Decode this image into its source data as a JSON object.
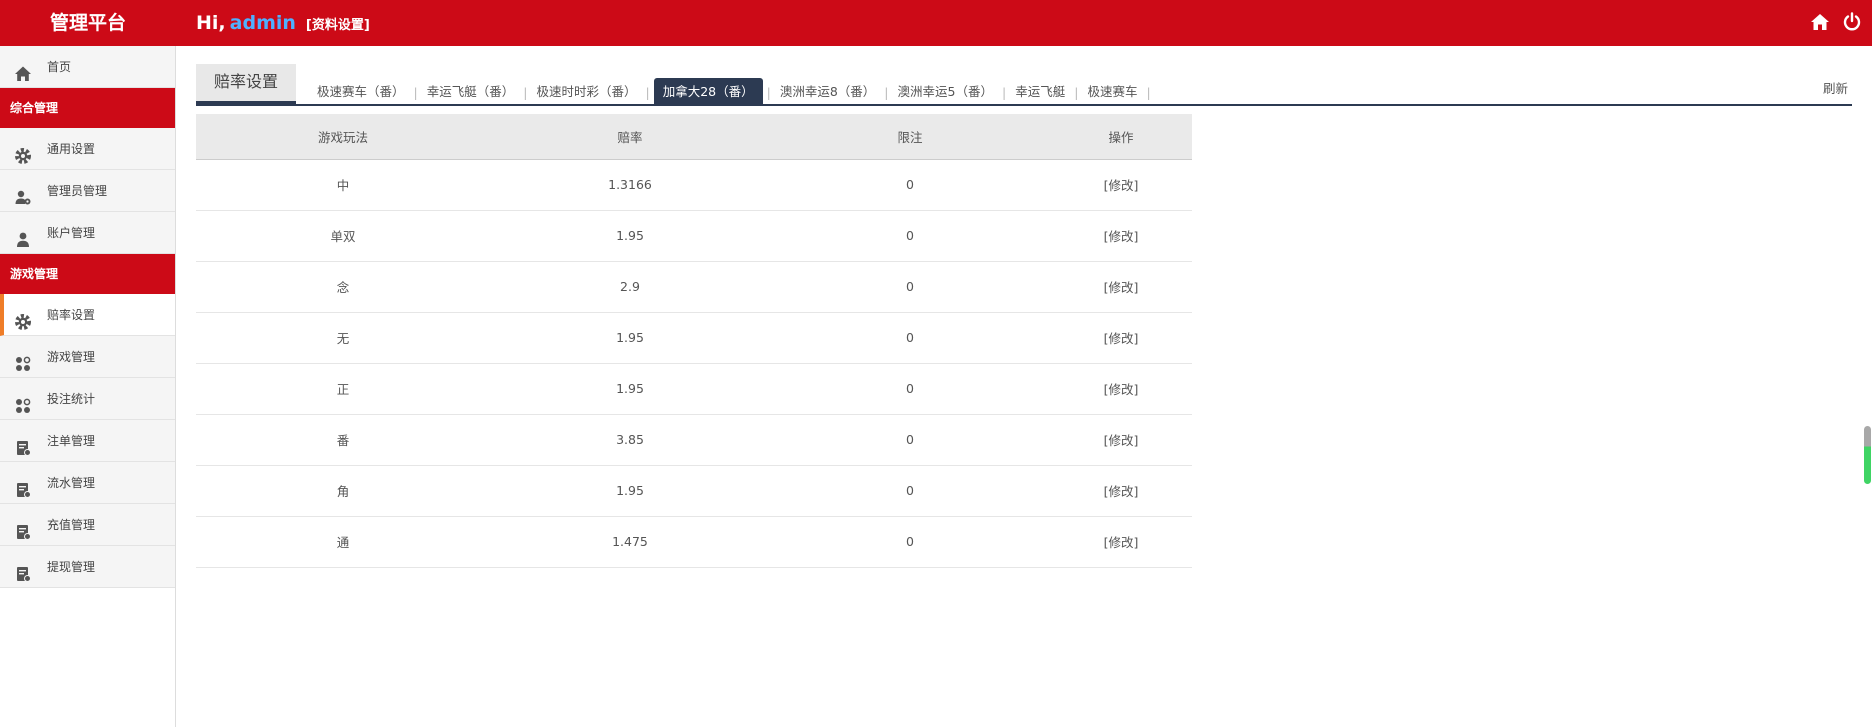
{
  "header": {
    "brand": "管理平台",
    "greeting": "Hi,",
    "username": "admin",
    "profile_link": "[资料设置]",
    "icons": [
      "home-icon",
      "power-icon"
    ]
  },
  "sidebar": {
    "home": "首页",
    "section_general": "综合管理",
    "general_items": [
      {
        "label": "通用设置",
        "icon": "gear-icon"
      },
      {
        "label": "管理员管理",
        "icon": "admin-users-icon"
      },
      {
        "label": "账户管理",
        "icon": "user-icon"
      }
    ],
    "section_game": "游戏管理",
    "game_items": [
      {
        "label": "赔率设置",
        "icon": "gear-icon",
        "active": true
      },
      {
        "label": "游戏管理",
        "icon": "apps-icon"
      },
      {
        "label": "投注统计",
        "icon": "apps-icon"
      },
      {
        "label": "注单管理",
        "icon": "ledger-icon"
      },
      {
        "label": "流水管理",
        "icon": "ledger-icon"
      },
      {
        "label": "充值管理",
        "icon": "ledger-icon"
      },
      {
        "label": "提现管理",
        "icon": "ledger-icon"
      }
    ]
  },
  "tabs": {
    "main": "赔率设置",
    "games": [
      "极速赛车（番）",
      "幸运飞艇（番）",
      "极速时时彩（番）",
      "加拿大28（番）",
      "澳洲幸运8（番）",
      "澳洲幸运5（番）",
      "幸运飞艇",
      "极速赛车"
    ],
    "active_game": "加拿大28（番）",
    "refresh": "刷新"
  },
  "table": {
    "headers": [
      "游戏玩法",
      "赔率",
      "限注",
      "操作"
    ],
    "rows": [
      [
        "中",
        "1.3166",
        "0",
        "[修改]"
      ],
      [
        "单双",
        "1.95",
        "0",
        "[修改]"
      ],
      [
        "念",
        "2.9",
        "0",
        "[修改]"
      ],
      [
        "无",
        "1.95",
        "0",
        "[修改]"
      ],
      [
        "正",
        "1.95",
        "0",
        "[修改]"
      ],
      [
        "番",
        "3.85",
        "0",
        "[修改]"
      ],
      [
        "角",
        "1.95",
        "0",
        "[修改]"
      ],
      [
        "通",
        "1.475",
        "0",
        "[修改]"
      ]
    ]
  },
  "colors": {
    "brand_red": "#cc0a17",
    "accent_navy": "#2c3a52",
    "active_marker": "#ef7d28",
    "username_blue": "#4fb0ff"
  }
}
